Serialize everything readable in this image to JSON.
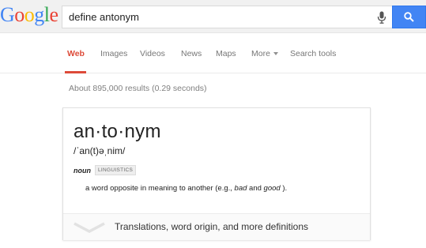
{
  "header": {
    "logo_letters": [
      {
        "char": "G",
        "color": "#4285f4"
      },
      {
        "char": "o",
        "color": "#ea4335"
      },
      {
        "char": "o",
        "color": "#fbbc05"
      },
      {
        "char": "g",
        "color": "#4285f4"
      },
      {
        "char": "l",
        "color": "#34a853"
      },
      {
        "char": "e",
        "color": "#ea4335"
      }
    ],
    "search_query": "define antonym",
    "mic_icon": "microphone-icon",
    "search_icon": "search-icon",
    "search_button_color": "#4285f4"
  },
  "tabs": {
    "web": "Web",
    "images": "Images",
    "videos": "Videos",
    "news": "News",
    "maps": "Maps",
    "more": "More",
    "search_tools": "Search tools",
    "active": "Web",
    "active_color": "#dd4b39"
  },
  "results": {
    "stats": "About 895,000 results (0.29 seconds)"
  },
  "dictionary": {
    "headword": "an·to·nym",
    "pronunciation": "/ˈan(t)əˌnim/",
    "part_of_speech": "noun",
    "domain_label": "LINGUISTICS",
    "definition_prefix": "a word opposite in meaning to another (e.g., ",
    "example_1": "bad",
    "definition_mid": " and ",
    "example_2": "good",
    "definition_suffix": " ).",
    "footer_link": "Translations, word origin, and more definitions",
    "footer_icon": "chevron-down-icon"
  }
}
